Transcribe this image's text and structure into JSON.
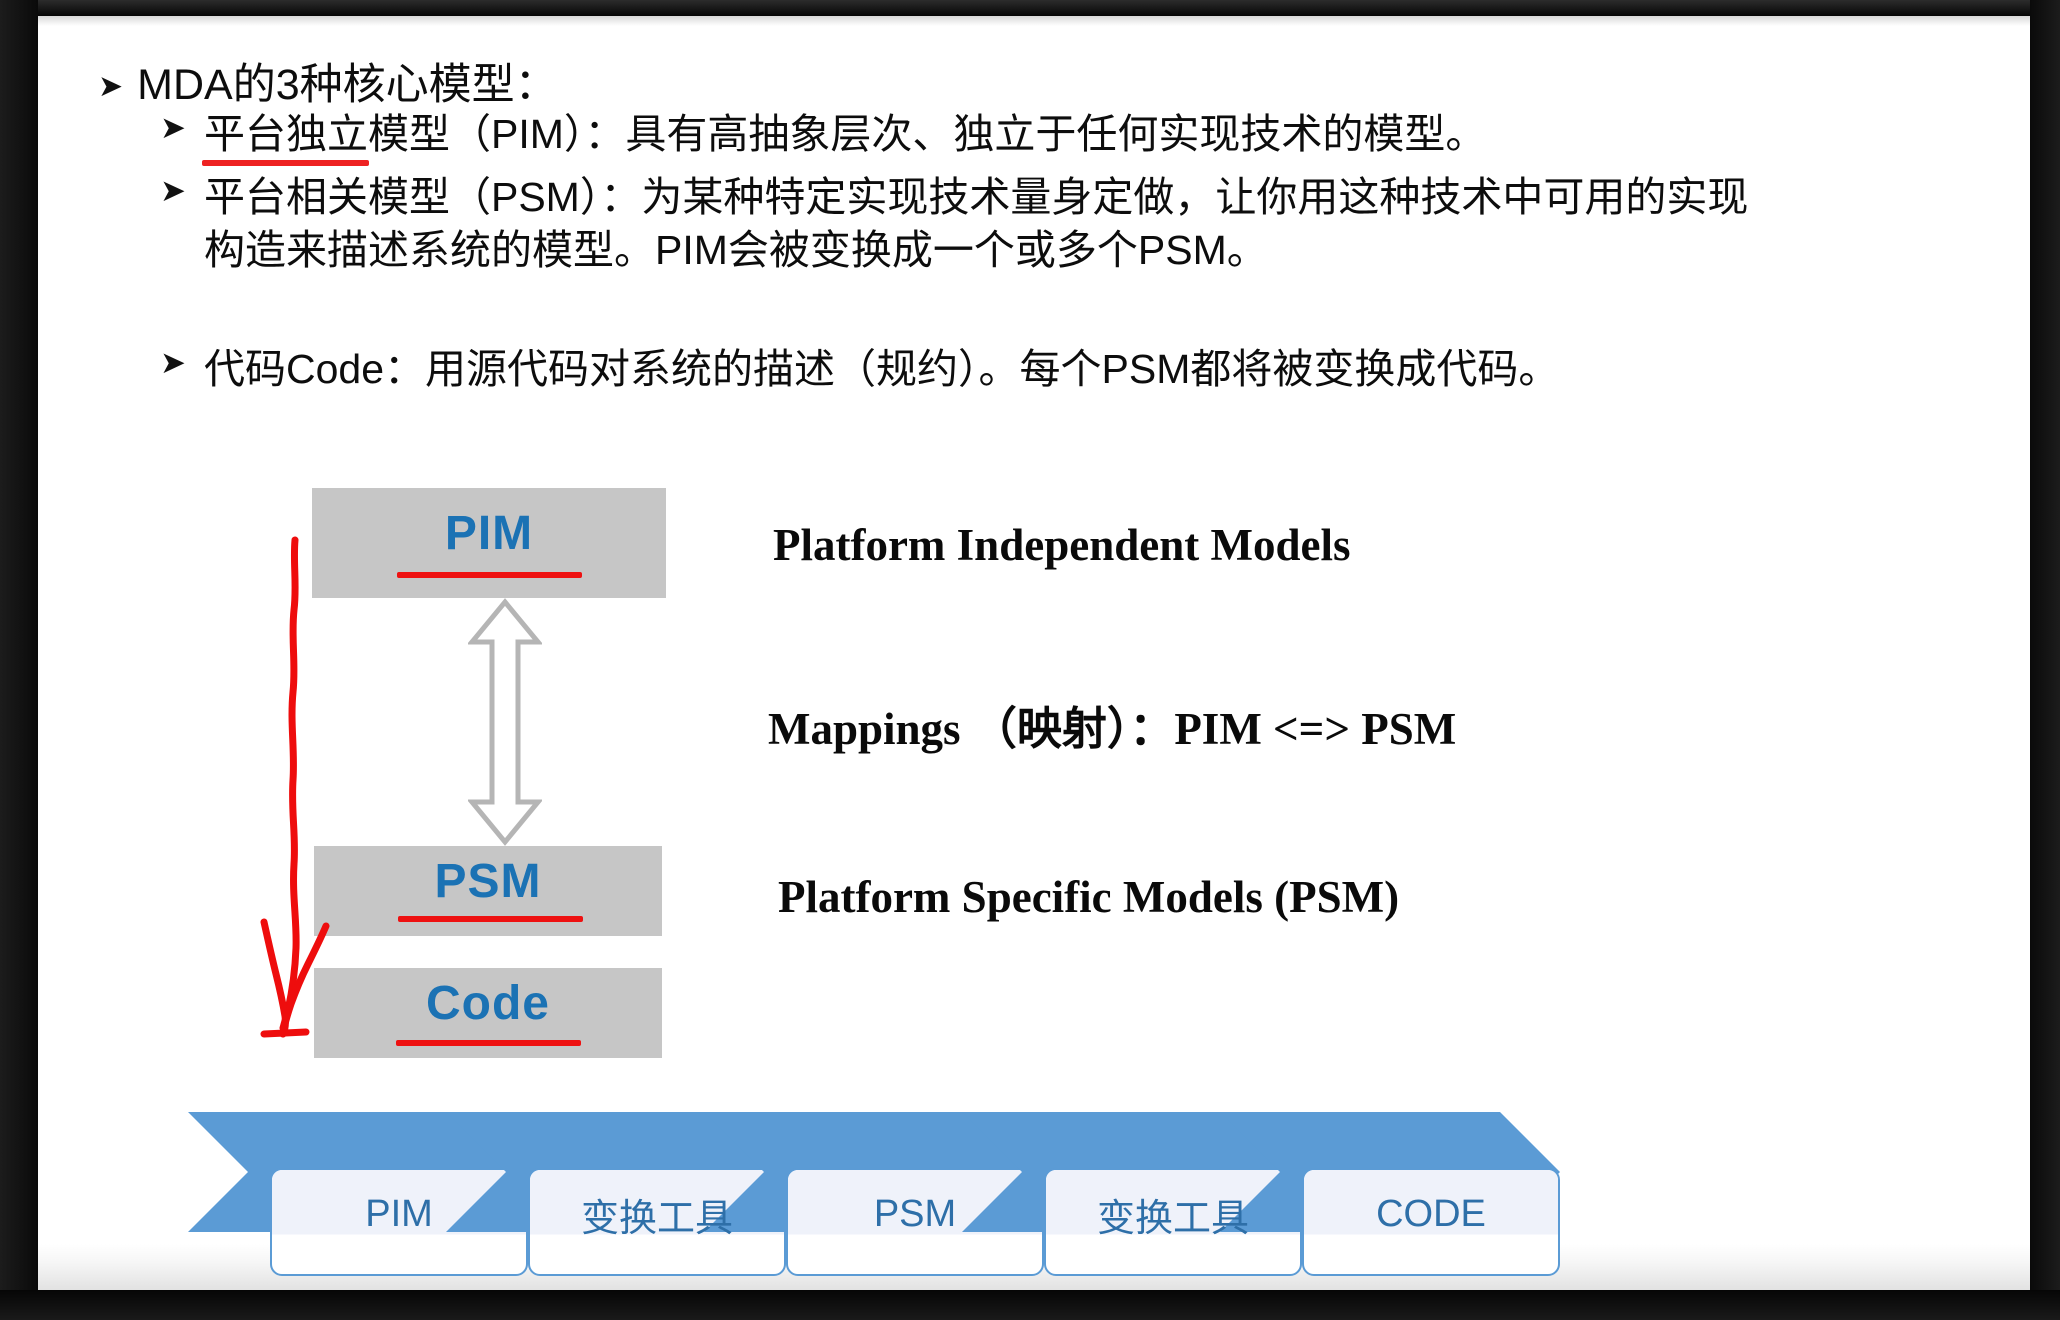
{
  "slide": {
    "heading": {
      "marker": "right-arrow-bullet",
      "text": "MDA的3种核心模型："
    },
    "bullets": [
      {
        "marker": "chevron-bullet",
        "underlined_prefix": "平台独立",
        "rest": "模型（PIM）：具有高抽象层次、独立于任何实现技术的模型。",
        "line2": ""
      },
      {
        "marker": "chevron-bullet",
        "underlined_prefix": "",
        "rest": "平台相关模型（PSM）：为某种特定实现技术量身定做，让你用这种技术中可用的实现",
        "line2": "构造来描述系统的模型。PIM会被变换成一个或多个PSM。"
      },
      {
        "marker": "chevron-bullet",
        "underlined_prefix": "",
        "rest": "代码Code：用源代码对系统的描述（规约）。每个PSM都将被变换成代码。",
        "line2": ""
      }
    ],
    "diagram": {
      "boxes": [
        {
          "label": "PIM",
          "name": "pim-box"
        },
        {
          "label": "PSM",
          "name": "psm-box"
        },
        {
          "label": "Code",
          "name": "code-box"
        }
      ],
      "captions": [
        "Platform Independent Models",
        "Mappings （映射）：PIM <=> PSM",
        "Platform Specific Models (PSM)"
      ],
      "arrow_name": "double-headed-vertical-arrow",
      "annotation_name": "red-handdrawn-arrow"
    },
    "flow": {
      "steps": [
        {
          "label": "PIM"
        },
        {
          "label": "变换工具"
        },
        {
          "label": "PSM"
        },
        {
          "label": "变换工具"
        },
        {
          "label": "CODE"
        }
      ]
    },
    "colors": {
      "box_fill": "#c6c6c6",
      "box_text": "#1b72b4",
      "underline_red": "#ee1111",
      "chevron_blue": "#5b9bd5",
      "card_text": "#2e6fa8"
    }
  }
}
